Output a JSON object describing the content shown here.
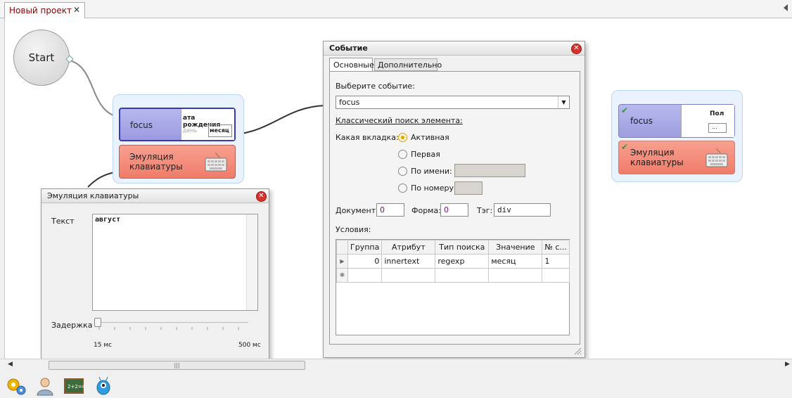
{
  "tabs": {
    "project_tab": "Новый проект",
    "close": "✕"
  },
  "canvas": {
    "start_label": "Start",
    "group1": {
      "focus_label": "focus",
      "focus_thumb_text1": "ата рождения",
      "focus_thumb_text2": "день",
      "focus_thumb_text3": "месяц",
      "kbd_label": "Эмуляция клавиатуры"
    },
    "group2": {
      "focus_label": "focus",
      "focus_thumb_text1": "Пол",
      "focus_thumb_text2": "...",
      "kbd_label": "Эмуляция клавиатуры"
    }
  },
  "kbd_dialog": {
    "title": "Эмуляция клавиатуры",
    "close": "✕",
    "text_label": "Текст",
    "text_value": "август",
    "delay_label": "Задержка",
    "delay_min": "15 мс",
    "delay_max": "500 мс"
  },
  "event_dialog": {
    "title": "Событие",
    "close": "✕",
    "tabs": [
      "Основные",
      "Дополнительно"
    ],
    "select_event_label": "Выберите событие:",
    "event_value": "focus",
    "classic_search_label": "Классический поиск элемента:",
    "which_tab_label": "Какая вкладка:",
    "radio_options": [
      "Активная",
      "Первая",
      "По имени:",
      "По номеру:"
    ],
    "document_label": "Документ:",
    "document_value": "0",
    "form_label": "Форма:",
    "form_value": "0",
    "tag_label": "Тэг:",
    "tag_value": "div",
    "conditions_label": "Условия:",
    "grid_headers": [
      "Группа",
      "Атрибут",
      "Тип поиска",
      "Значение",
      "№ с..."
    ],
    "grid_rows": [
      [
        "0",
        "innertext",
        "regexp",
        "месяц",
        "1"
      ]
    ]
  },
  "scroll": {
    "thumb_grip": "|||"
  }
}
